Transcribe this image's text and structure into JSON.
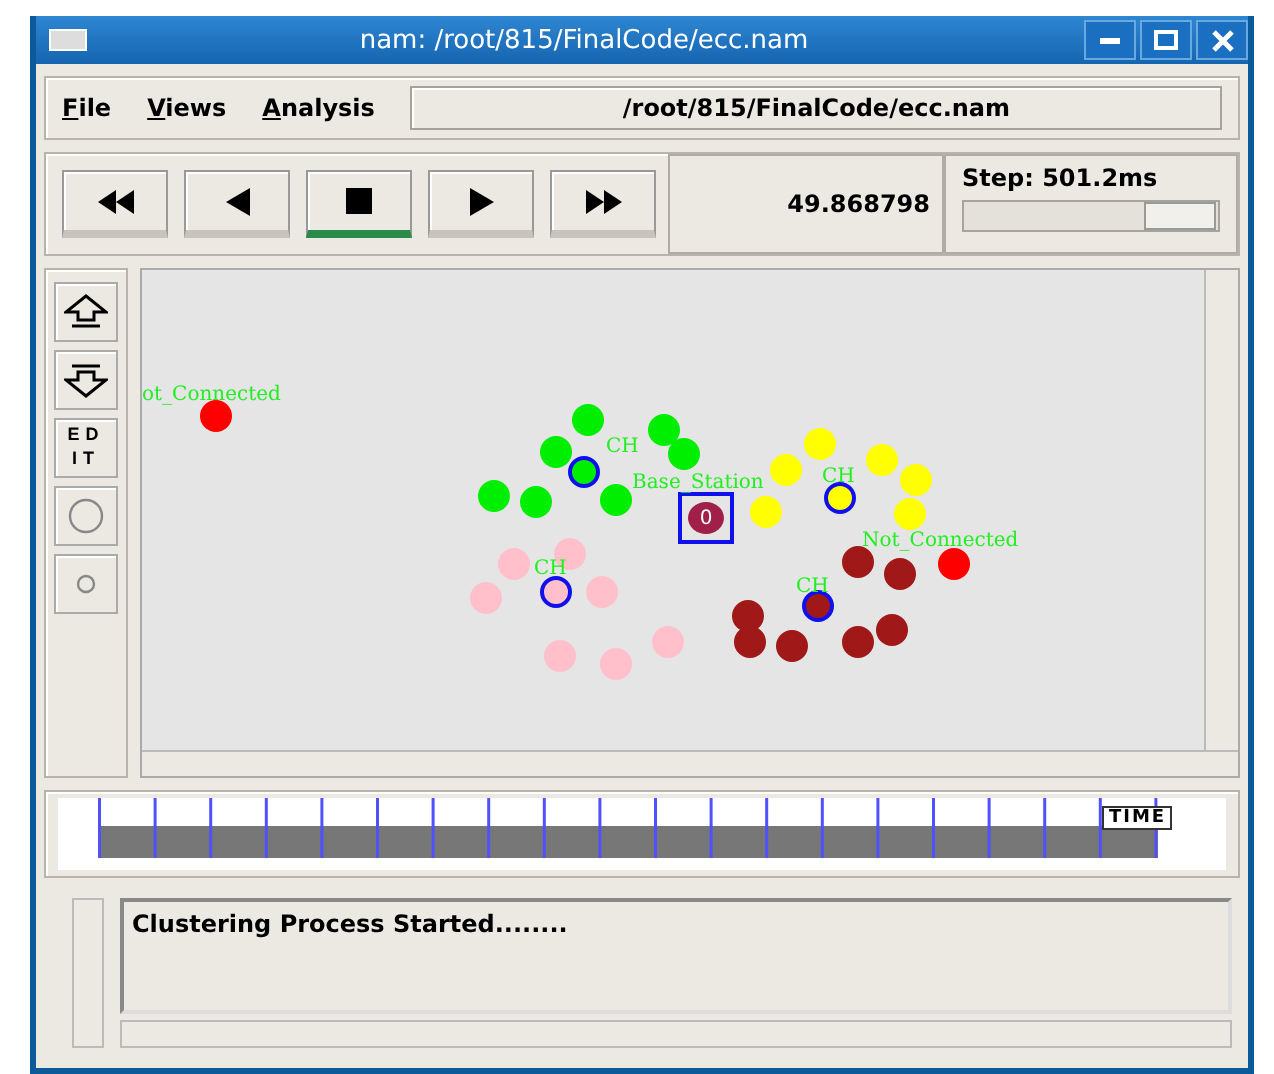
{
  "window": {
    "title": "nam: /root/815/FinalCode/ecc.nam"
  },
  "menu": [
    {
      "label": "File"
    },
    {
      "label": "Views"
    },
    {
      "label": "Analysis"
    }
  ],
  "file_path": "/root/815/FinalCode/ecc.nam",
  "playback": [
    {
      "kind": "rewind",
      "selected": false
    },
    {
      "kind": "back",
      "selected": false
    },
    {
      "kind": "stop",
      "selected": true
    },
    {
      "kind": "play",
      "selected": false
    },
    {
      "kind": "forward",
      "selected": false
    }
  ],
  "time": "49.868798",
  "step": {
    "label": "Step: 501.2ms",
    "level": 0.85
  },
  "tools": [
    {
      "kind": "zoom_in"
    },
    {
      "kind": "zoom_out"
    },
    {
      "kind": "edit",
      "label": "EDIT"
    },
    {
      "kind": "big_circle"
    },
    {
      "kind": "small_circle"
    }
  ],
  "nodes": [
    {
      "color": "#ff0000",
      "kind": "node"
    },
    {
      "color": "#00ee00",
      "kind": "node"
    },
    {
      "color": "#00ee00",
      "kind": "node"
    },
    {
      "color": "#00ee00",
      "kind": "node"
    },
    {
      "color": "#00ee00",
      "kind": "node"
    },
    {
      "color": "#00ee00",
      "kind": "head"
    },
    {
      "color": "#00ee00",
      "kind": "node"
    },
    {
      "color": "#00ee00",
      "kind": "node"
    },
    {
      "color": "#00ee00",
      "kind": "node"
    },
    {
      "color": "#ffff00",
      "kind": "node"
    },
    {
      "color": "#ffff00",
      "kind": "node"
    },
    {
      "color": "#ffff00",
      "kind": "node"
    },
    {
      "color": "#ffff00",
      "kind": "node"
    },
    {
      "color": "#ffff00",
      "kind": "node"
    },
    {
      "color": "#ffff00",
      "kind": "node"
    },
    {
      "color": "#ffff00",
      "kind": "head"
    },
    {
      "color": "#a0204a",
      "kind": "base",
      "label": "0"
    },
    {
      "color": "#ff0000",
      "kind": "node"
    },
    {
      "color": "#a01818",
      "kind": "node"
    },
    {
      "color": "#a01818",
      "kind": "node"
    },
    {
      "color": "#a01818",
      "kind": "head"
    },
    {
      "color": "#a01818",
      "kind": "node"
    },
    {
      "color": "#a01818",
      "kind": "node"
    },
    {
      "color": "#a01818",
      "kind": "node"
    },
    {
      "color": "#a01818",
      "kind": "node"
    },
    {
      "color": "#a01818",
      "kind": "node"
    },
    {
      "color": "#ffc0cb",
      "kind": "node"
    },
    {
      "color": "#ffc0cb",
      "kind": "node"
    },
    {
      "color": "#ffc0cb",
      "kind": "head"
    },
    {
      "color": "#ffc0cb",
      "kind": "node"
    },
    {
      "color": "#ffc0cb",
      "kind": "node"
    },
    {
      "color": "#ffc0cb",
      "kind": "node"
    },
    {
      "color": "#ffc0cb",
      "kind": "node"
    },
    {
      "color": "#ffc0cb",
      "kind": "node"
    }
  ],
  "node_labels": [
    "ot_Connected",
    "CH",
    "Base_Station",
    "CH",
    "CH",
    "Not_Connected",
    "CH"
  ],
  "timeline": {
    "label": "TIME",
    "level": 0.97
  },
  "log": {
    "text": "Clustering Process Started........"
  }
}
